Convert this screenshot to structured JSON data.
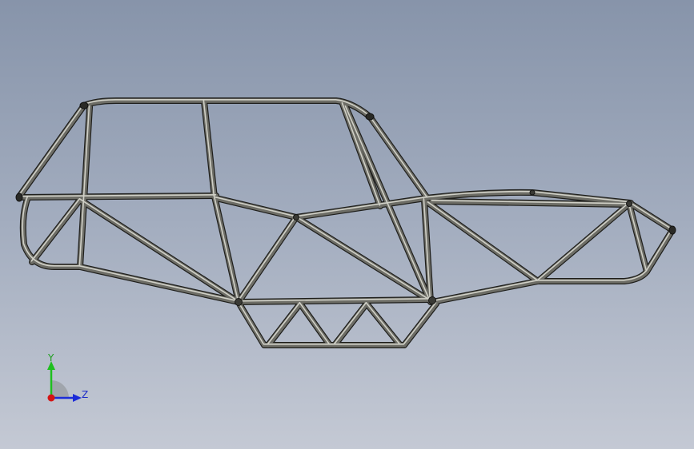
{
  "viewport": {
    "background_top": "#8794aa",
    "background_bottom": "#c4c9d4"
  },
  "model": {
    "tube_color": "#6d6d66",
    "tube_highlight": "#e2e2d8",
    "tube_shadow": "#1e1e1b"
  },
  "triad": {
    "y_label": "Y",
    "z_label": "Z",
    "y_color": "#1fbf1f",
    "z_color": "#1c2cd8",
    "x_color": "#d41414"
  }
}
